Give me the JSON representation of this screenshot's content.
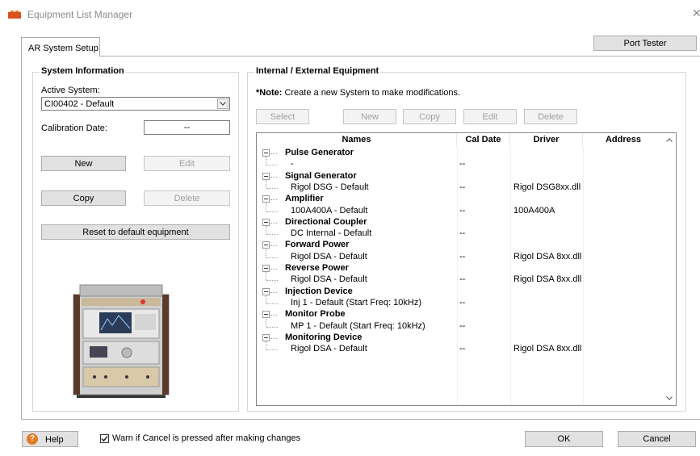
{
  "window": {
    "title": "Equipment List Manager"
  },
  "tabs": [
    {
      "label": "AR System Setup"
    }
  ],
  "port_tester_label": "Port Tester",
  "system_info": {
    "title": "System Information",
    "active_system_label": "Active System:",
    "active_system_value": "CI00402 - Default",
    "calibration_date_label": "Calibration Date:",
    "calibration_date_value": "--",
    "new_label": "New",
    "edit_label": "Edit",
    "copy_label": "Copy",
    "delete_label": "Delete",
    "reset_label": "Reset to default equipment"
  },
  "equipment": {
    "title": "Internal / External Equipment",
    "note_prefix": "*Note:",
    "note_text": " Create a new System to make modifications.",
    "buttons": {
      "select": "Select",
      "new": "New",
      "copy": "Copy",
      "edit": "Edit",
      "delete": "Delete"
    },
    "columns": [
      "Names",
      "Cal Date",
      "Driver",
      "Address"
    ],
    "groups": [
      {
        "name": "Pulse Generator",
        "child": "-",
        "cal": "--",
        "driver": "",
        "address": ""
      },
      {
        "name": "Signal Generator",
        "child": "Rigol DSG - Default",
        "cal": "--",
        "driver": "Rigol DSG8xx.dll",
        "address": ""
      },
      {
        "name": "Amplifier",
        "child": "100A400A - Default",
        "cal": "--",
        "driver": "100A400A",
        "address": ""
      },
      {
        "name": "Directional Coupler",
        "child": "DC Internal - Default",
        "cal": "--",
        "driver": "",
        "address": ""
      },
      {
        "name": "Forward Power",
        "child": "Rigol DSA - Default",
        "cal": "--",
        "driver": "Rigol DSA 8xx.dll",
        "address": ""
      },
      {
        "name": "Reverse Power",
        "child": "Rigol DSA - Default",
        "cal": "--",
        "driver": "Rigol DSA 8xx.dll",
        "address": ""
      },
      {
        "name": "Injection Device",
        "child": "Inj 1 - Default (Start Freq: 10kHz)",
        "cal": "--",
        "driver": "",
        "address": ""
      },
      {
        "name": "Monitor Probe",
        "child": "MP 1 - Default (Start Freq: 10kHz)",
        "cal": "--",
        "driver": "",
        "address": ""
      },
      {
        "name": "Monitoring Device",
        "child": "Rigol DSA - Default",
        "cal": "--",
        "driver": "Rigol DSA 8xx.dll",
        "address": ""
      }
    ]
  },
  "footer": {
    "help_label": "Help",
    "warn_checked": true,
    "warn_label": "Warn if Cancel is pressed after making changes",
    "ok_label": "OK",
    "cancel_label": "Cancel"
  },
  "colors": {
    "accent": "#e07c24",
    "border": "#adadad",
    "button_face": "#e1e1e1"
  },
  "icons": [
    "app-icon",
    "close-icon",
    "chevron-down-icon",
    "help-icon",
    "check-icon",
    "scroll-up-icon",
    "scroll-down-icon"
  ]
}
